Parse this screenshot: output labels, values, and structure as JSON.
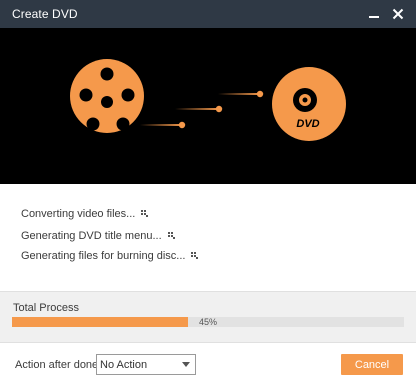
{
  "window": {
    "title": "Create DVD",
    "minimize_icon": "minimize-icon",
    "close_icon": "close-icon"
  },
  "banner": {
    "film_reel_icon": "film-reel-icon",
    "dvd_disc_icon": "dvd-disc-icon",
    "disc_label": "DVD",
    "accent_color": "#f5994b"
  },
  "steps": [
    {
      "label": "Converting video files...",
      "status_icon": "progress-dots-icon"
    },
    {
      "label": "Generating DVD title menu...",
      "status_icon": "progress-dots-icon"
    },
    {
      "label": "Generating files for burning disc...",
      "status_icon": "progress-dots-icon"
    }
  ],
  "progress": {
    "label": "Total Process",
    "percent": 45,
    "percent_text": "45%"
  },
  "footer": {
    "action_label": "Action after done:",
    "action_selected": "No Action",
    "cancel_label": "Cancel"
  },
  "colors": {
    "titlebar": "#2f3945",
    "accent": "#f5994b",
    "banner_bg": "#000000"
  }
}
